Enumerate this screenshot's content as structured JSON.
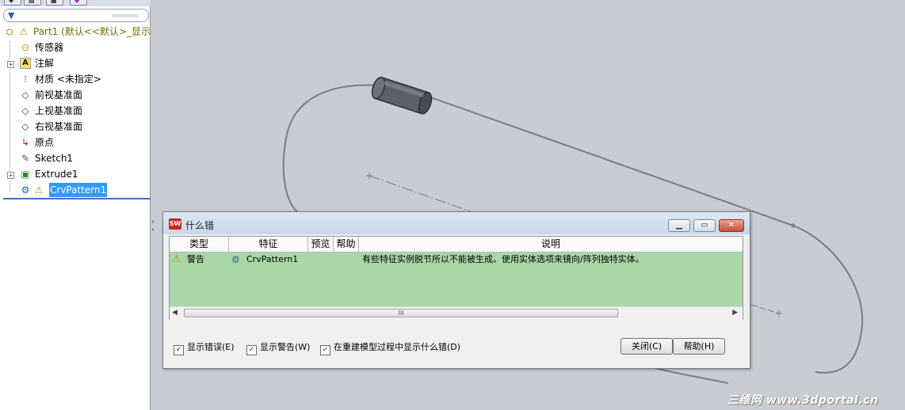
{
  "feature_tree": {
    "root_label": "Part1  (默认<<默认>_显示",
    "items": [
      {
        "label": "传感器",
        "icon": "sensor-icon"
      },
      {
        "label": "注解",
        "icon": "annotation-icon"
      },
      {
        "label": "材质 <未指定>",
        "icon": "material-icon"
      },
      {
        "label": "前视基准面",
        "icon": "plane-icon"
      },
      {
        "label": "上视基准面",
        "icon": "plane-icon"
      },
      {
        "label": "右视基准面",
        "icon": "plane-icon"
      },
      {
        "label": "原点",
        "icon": "origin-icon"
      },
      {
        "label": "Sketch1",
        "icon": "sketch-icon"
      },
      {
        "label": "Extrude1",
        "icon": "extrude-icon"
      },
      {
        "label": "CrvPattern1",
        "icon": "curve-pattern-icon"
      }
    ]
  },
  "dialog": {
    "title": "什么错",
    "columns": [
      "类型",
      "特征",
      "预览",
      "帮助",
      "说明"
    ],
    "rows": [
      {
        "type": "警告",
        "feature": "CrvPattern1",
        "description": "有些特征实例脱节所以不能被生成。使用实体选项来镜向/阵列独特实体。"
      }
    ],
    "scroll_grip": "III",
    "checkboxes": [
      {
        "label": "显示错误(E)",
        "checked": true
      },
      {
        "label": "显示警告(W)",
        "checked": true
      },
      {
        "label": "在重建模型过程中显示什么错(D)",
        "checked": true
      }
    ],
    "close_label": "关闭(C)",
    "help_label": "帮助(H)"
  },
  "watermark": "三维网 www.3dportal.cn",
  "colors": {
    "viewport_bg": "#c9ccd3",
    "selection": "#3399ff",
    "warning_row": "#a8d8a8",
    "titlebar": "#dfe8f4"
  }
}
